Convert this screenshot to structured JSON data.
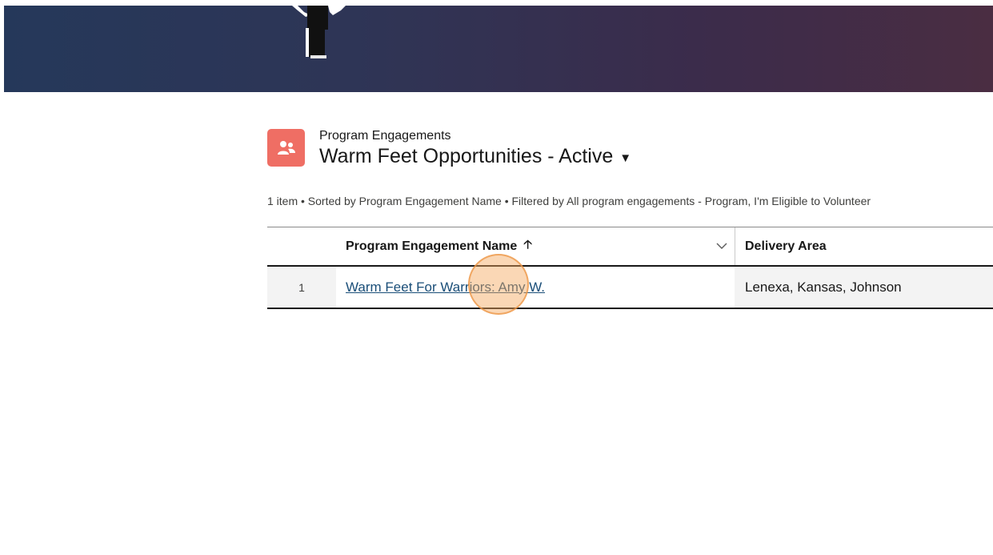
{
  "header": {
    "object_label": "Program Engagements",
    "list_view_title": "Warm Feet Opportunities - Active",
    "object_icon": "people-icon",
    "title_dropdown_icon": "caret-down-icon"
  },
  "list_meta": "1 item • Sorted by Program Engagement Name • Filtered by All program engagements - Program, I'm Eligible to Volunteer",
  "table": {
    "columns": [
      {
        "label": "Program Engagement Name",
        "sort_icon": "arrow-up-icon"
      },
      {
        "label": "Delivery Area"
      }
    ],
    "rows": [
      {
        "num": "1",
        "name": "Warm Feet For Warriors: Amy W.",
        "delivery_area": "Lenexa, Kansas, Johnson"
      }
    ]
  },
  "colors": {
    "banner_start": "#25385a",
    "banner_end": "#4a2d42",
    "object_icon_bg": "#ef6e64",
    "link": "#1a4e78",
    "click_marker": "#f5a65a"
  }
}
